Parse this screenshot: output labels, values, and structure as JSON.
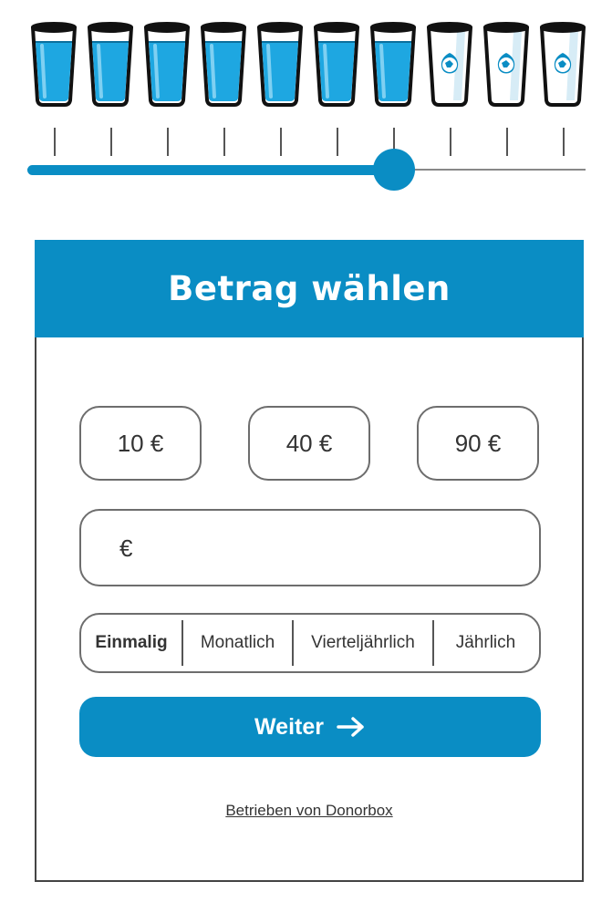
{
  "glasses": {
    "count": 10,
    "filled_count": 7,
    "filled_icon": "water-glass-full-icon",
    "empty_icon": "water-glass-empty-earth-icon",
    "water_color": "#1ea7e1",
    "accent_color": "#0a8dc4"
  },
  "slider": {
    "steps": 10,
    "selected_step": 7
  },
  "card": {
    "title": "Betrag wählen",
    "amount_options": [
      "10 €",
      "40 €",
      "90 €"
    ],
    "custom_amount": {
      "currency_symbol": "€",
      "value": "",
      "placeholder": ""
    },
    "frequency": {
      "options": [
        "Einmalig",
        "Monatlich",
        "Vierteljährlich",
        "Jährlich"
      ],
      "selected": "Einmalig"
    },
    "next_button": {
      "label": "Weiter",
      "icon": "arrow-right-icon"
    },
    "powered_by": "Betrieben von Donorbox"
  }
}
